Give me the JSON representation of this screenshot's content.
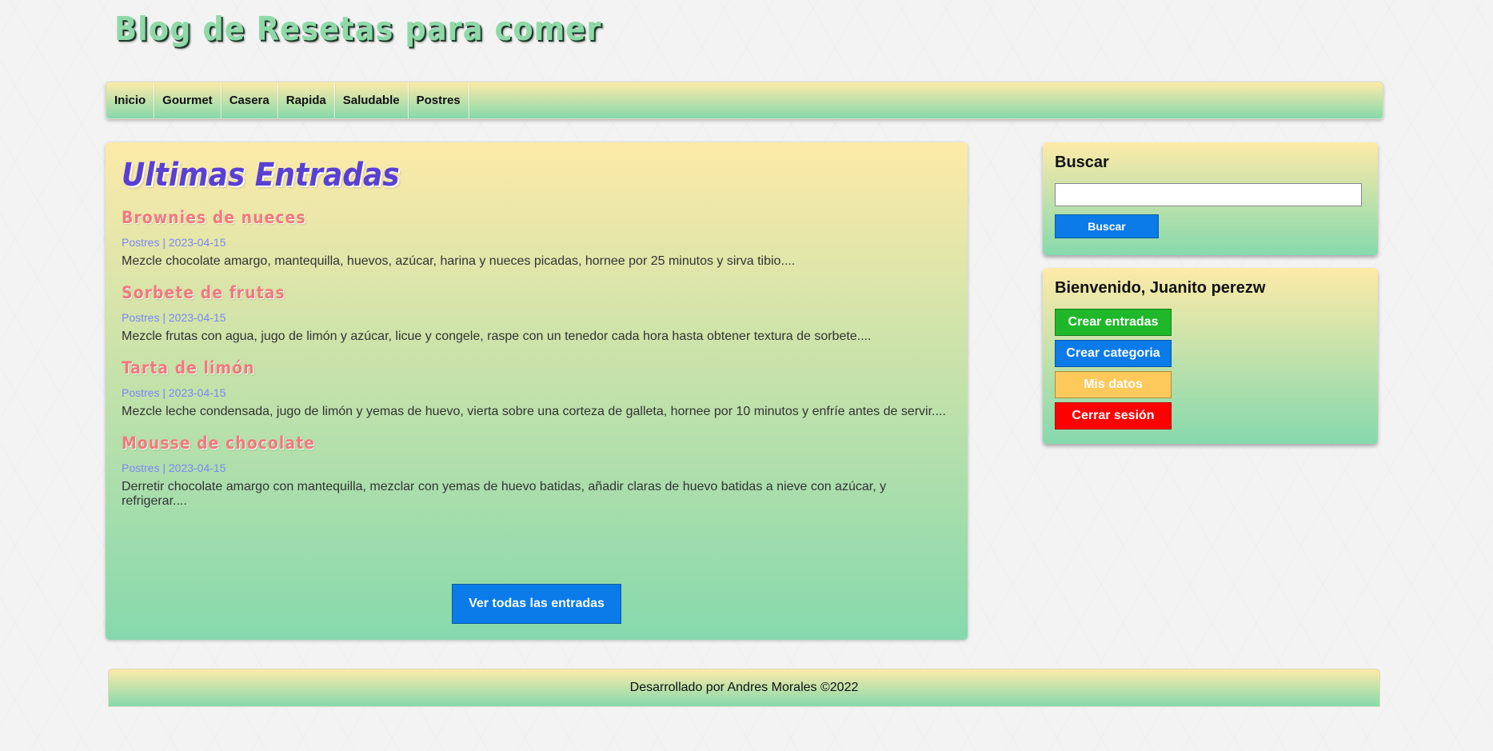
{
  "site": {
    "title": "Blog de Resetas para comer"
  },
  "nav": {
    "items": [
      {
        "label": "Inicio"
      },
      {
        "label": "Gourmet"
      },
      {
        "label": "Casera"
      },
      {
        "label": "Rapida"
      },
      {
        "label": "Saludable"
      },
      {
        "label": "Postres"
      }
    ]
  },
  "main": {
    "title": "Ultimas Entradas",
    "entries": [
      {
        "title": "Brownies de nueces",
        "meta": "Postres | 2023-04-15",
        "text": "Mezcle chocolate amargo, mantequilla, huevos, azúcar, harina y nueces picadas, hornee por 25 minutos y sirva tibio...."
      },
      {
        "title": "Sorbete de frutas",
        "meta": "Postres | 2023-04-15",
        "text": "Mezcle frutas con agua, jugo de limón y azúcar, licue y congele, raspe con un tenedor cada hora hasta obtener textura de sorbete...."
      },
      {
        "title": "Tarta de limón",
        "meta": "Postres | 2023-04-15",
        "text": "Mezcle leche condensada, jugo de limón y yemas de huevo, vierta sobre una corteza de galleta, hornee por 10 minutos y enfríe antes de servir...."
      },
      {
        "title": "Mousse de chocolate",
        "meta": "Postres | 2023-04-15",
        "text": "Derretir chocolate amargo con mantequilla, mezclar con yemas de huevo batidas, añadir claras de huevo batidas a nieve con azúcar, y refrigerar...."
      }
    ],
    "view_all_label": "Ver todas las entradas"
  },
  "sidebar": {
    "search": {
      "title": "Buscar",
      "value": "",
      "button_label": "Buscar"
    },
    "user": {
      "welcome": "Bienvenido, Juanito perezw",
      "buttons": [
        {
          "label": "Crear entradas",
          "color": "#1fb82a"
        },
        {
          "label": "Crear categoria",
          "color": "#0a7be8"
        },
        {
          "label": "Mis datos",
          "color": "#fdc95a"
        },
        {
          "label": "Cerrar sesión",
          "color": "#ff0000"
        }
      ]
    }
  },
  "footer": {
    "text": "Desarrollado por Andres Morales ©2022"
  },
  "colors": {
    "gradient_top": "#fdeaa8",
    "gradient_bottom": "#86d9ad",
    "primary": "#0a7be8",
    "title_purple": "#5a3fd4",
    "entry_title": "#f07a7a",
    "meta": "#7b86f3"
  }
}
